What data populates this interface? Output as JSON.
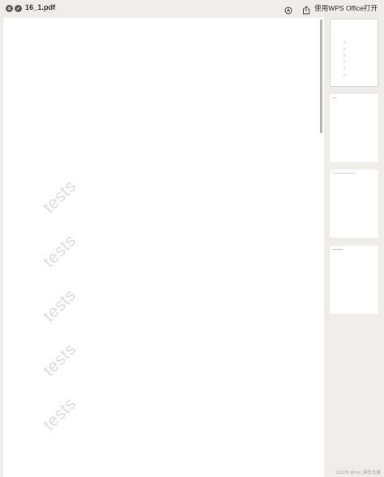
{
  "titlebar": {
    "title": "16_1.pdf",
    "close_icon": "close-icon",
    "minimize_icon": "stop-icon",
    "annotate_icon": "annotate-icon",
    "share_icon": "share-icon",
    "open_with_label": "使用WPS Office打开"
  },
  "document": {
    "watermark_text": "tests",
    "watermarks": [
      "tests",
      "tests",
      "tests",
      "tests",
      "tests"
    ]
  },
  "sidebar": {
    "thumbnails": [
      {
        "page": 1,
        "selected": true
      },
      {
        "page": 2,
        "selected": false
      },
      {
        "page": 3,
        "selected": false
      },
      {
        "page": 4,
        "selected": false
      }
    ]
  },
  "footer": {
    "credit": "CSDN @rss_摸鱼玄鉴"
  }
}
